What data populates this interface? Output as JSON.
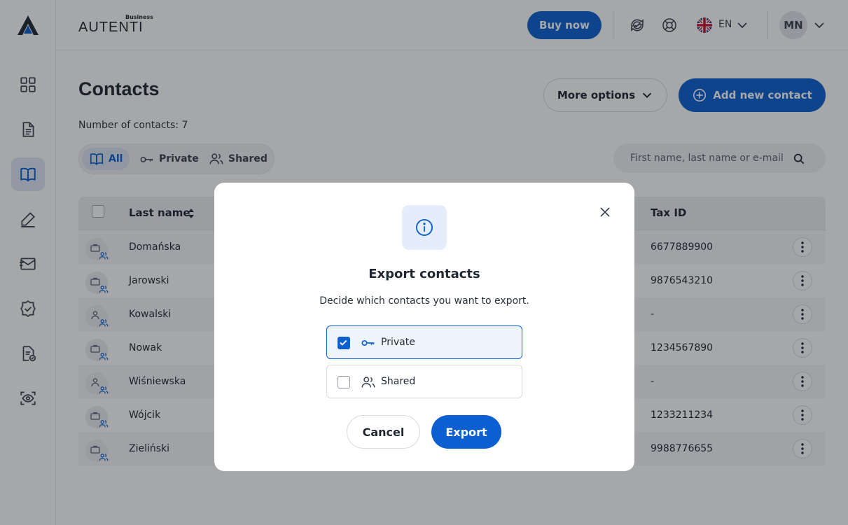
{
  "brand": {
    "business_label": "Business",
    "wordmark": "AUTENTI"
  },
  "header": {
    "buy_now_label": "Buy now",
    "language": "EN",
    "avatar_initials": "MN"
  },
  "sidebar": {
    "items": [
      {
        "name": "dashboard",
        "icon": "grid-icon"
      },
      {
        "name": "documents",
        "icon": "document-icon"
      },
      {
        "name": "contacts",
        "icon": "book-icon",
        "active": true
      },
      {
        "name": "sign",
        "icon": "pen-icon"
      },
      {
        "name": "messages",
        "icon": "mail-icon"
      },
      {
        "name": "verification",
        "icon": "badge-check-icon"
      },
      {
        "name": "templates",
        "icon": "file-check-icon"
      },
      {
        "name": "identity",
        "icon": "eye-scan-icon"
      }
    ]
  },
  "main": {
    "title": "Contacts",
    "count_label": "Number of contacts: 7",
    "more_options_label": "More options",
    "add_contact_label": "Add new contact",
    "filters": [
      {
        "label": "All",
        "icon": "book-icon",
        "active": true
      },
      {
        "label": "Private",
        "icon": "key-icon"
      },
      {
        "label": "Shared",
        "icon": "users-icon"
      }
    ],
    "search_placeholder": "First name, last name or e-mail"
  },
  "table": {
    "columns": {
      "last_name": "Last name",
      "tax_id": "Tax ID"
    },
    "rows": [
      {
        "type": "company",
        "last_name": "Domańska",
        "tax_id": "6677889900"
      },
      {
        "type": "company",
        "last_name": "Jarowski",
        "tax_id": "9876543210"
      },
      {
        "type": "person",
        "last_name": "Kowalski",
        "tax_id": "-"
      },
      {
        "type": "company",
        "last_name": "Nowak",
        "tax_id": "1234567890"
      },
      {
        "type": "person",
        "last_name": "Wiśniewska",
        "tax_id": "-"
      },
      {
        "type": "company",
        "last_name": "Wójcik",
        "tax_id": "1233211234"
      },
      {
        "type": "company",
        "last_name": "Zieliński",
        "tax_id": "9988776655"
      }
    ]
  },
  "modal": {
    "title": "Export contacts",
    "description": "Decide which contacts you want to export.",
    "options": [
      {
        "label": "Private",
        "icon": "key-icon",
        "checked": true
      },
      {
        "label": "Shared",
        "icon": "users-icon",
        "checked": false
      }
    ],
    "cancel_label": "Cancel",
    "export_label": "Export"
  },
  "colors": {
    "primary": "#0b5fd0",
    "overlay": "rgba(20,24,30,0.38)"
  }
}
